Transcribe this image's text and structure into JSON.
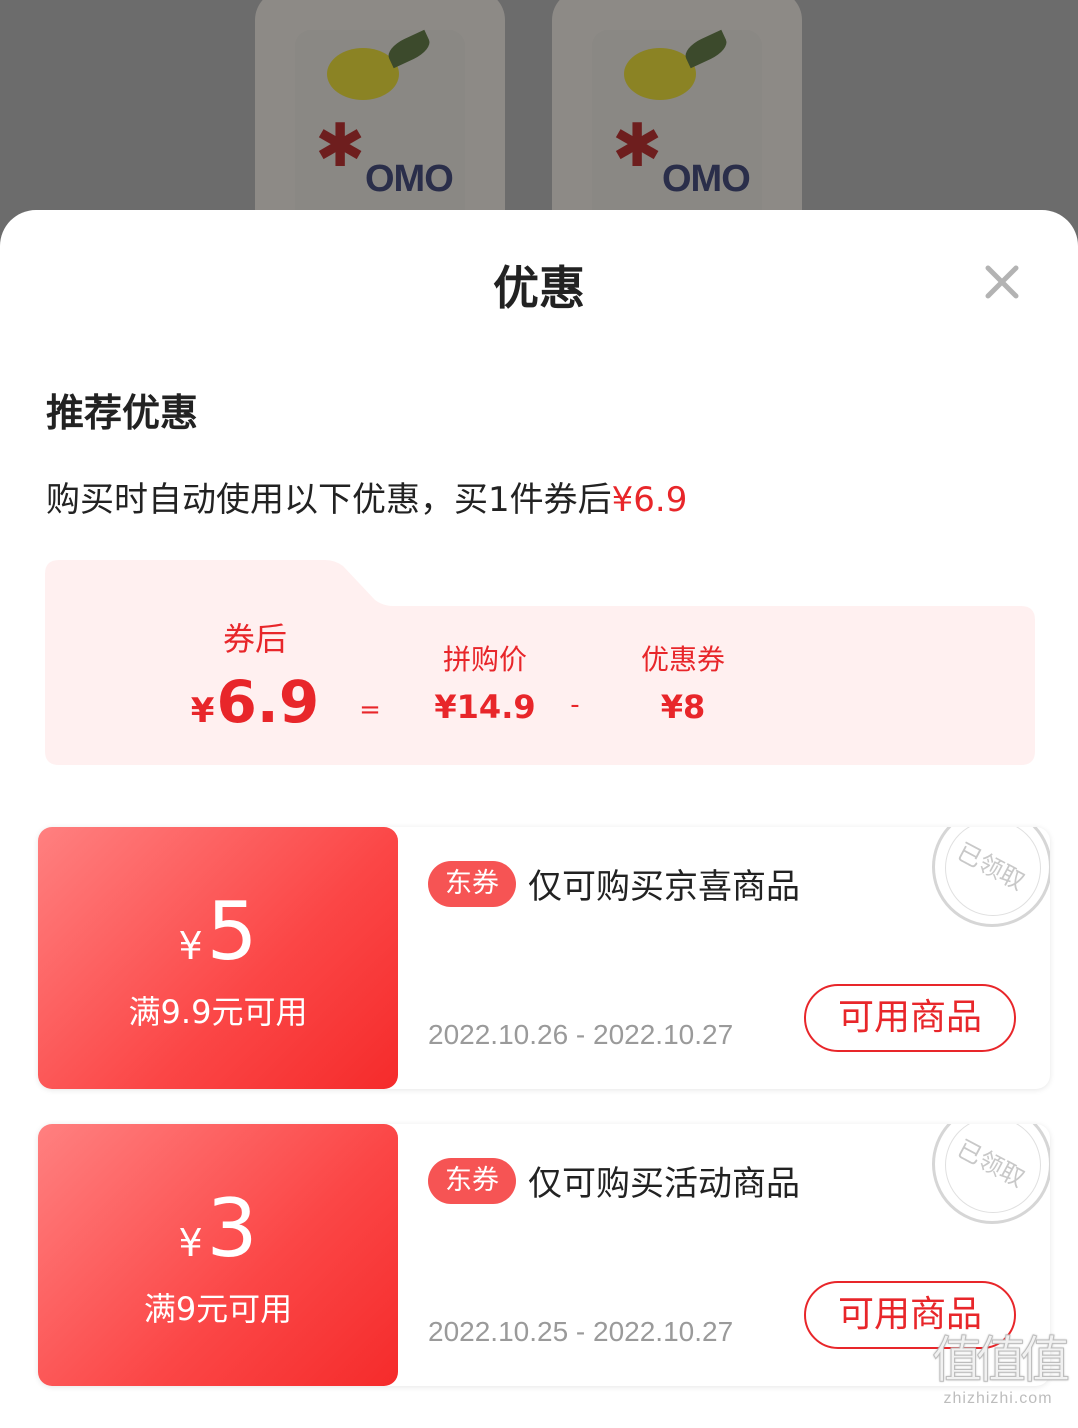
{
  "sheet": {
    "title": "优惠",
    "close_icon": "close-icon"
  },
  "recommend": {
    "title": "推荐优惠",
    "hint_text": "购买时自动使用以下优惠，买1件券后",
    "hint_price": "¥6.9"
  },
  "breakdown": {
    "final_label": "券后",
    "final_currency": "¥",
    "final_value": "6.9",
    "equals": "=",
    "group_price_label": "拼购价",
    "group_price_value": "¥14.9",
    "minus": "-",
    "coupon_label": "优惠券",
    "coupon_value": "¥8"
  },
  "coupons": [
    {
      "currency": "¥",
      "amount": "5",
      "condition": "满9.9元可用",
      "tag": "东券",
      "description": "仅可购买京喜商品",
      "date_range": "2022.10.26 - 2022.10.27",
      "button_label": "可用商品",
      "stamp_text": "已领取"
    },
    {
      "currency": "¥",
      "amount": "3",
      "condition": "满9元可用",
      "tag": "东券",
      "description": "仅可购买活动商品",
      "date_range": "2022.10.25 - 2022.10.27",
      "button_label": "可用商品",
      "stamp_text": "已领取"
    }
  ],
  "background_product": {
    "brand": "OMO"
  },
  "watermark": {
    "glyphs": "值值值",
    "site": "zhizhizhi.com"
  },
  "colors": {
    "accent_red": "#e8262a",
    "coupon_gradient_start": "#ff8080",
    "coupon_gradient_end": "#f52b2b",
    "breakdown_bg": "#fff0f0"
  }
}
